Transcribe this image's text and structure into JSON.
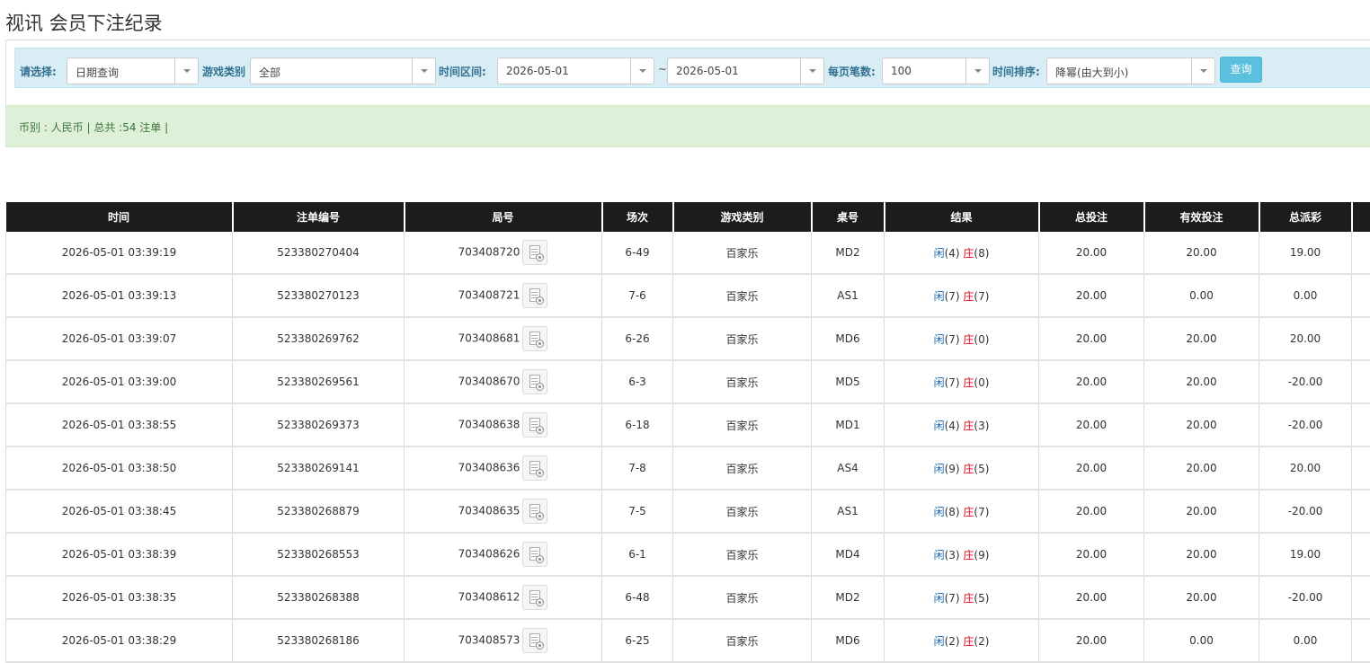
{
  "page": {
    "title": "视讯 会员下注纪录"
  },
  "filters": {
    "select_label": "请选择:",
    "select_value": "日期查询",
    "game_type_label": "游戏类别",
    "game_type_value": "全部",
    "time_range_label": "时间区间:",
    "date_from": "2026-05-01",
    "tilde": "~",
    "date_to": "2026-05-01",
    "per_page_label": "每页笔数:",
    "per_page_value": "100",
    "sort_label": "时间排序:",
    "sort_value": "降幂(由大到小)",
    "query_label": "查询"
  },
  "summary": {
    "text": "币别 : 人民币 | 总共 :54 注单 |"
  },
  "table": {
    "headers": [
      "时间",
      "注单编号",
      "局号",
      "场次",
      "游戏类别",
      "桌号",
      "结果",
      "总投注",
      "有效投注",
      "总派彩"
    ],
    "rows": [
      {
        "time": "2026-05-01 03:39:19",
        "order_no": "523380270404",
        "round_no": "703408720",
        "session": "6-49",
        "game": "百家乐",
        "table_no": "MD2",
        "player_label": "闲",
        "player_score": "(4)",
        "banker_label": "庄",
        "banker_score": "(8)",
        "total_bet": "20.00",
        "valid_bet": "20.00",
        "payout": "19.00",
        "payout_color": "normal"
      },
      {
        "time": "2026-05-01 03:39:13",
        "order_no": "523380270123",
        "round_no": "703408721",
        "session": "7-6",
        "game": "百家乐",
        "table_no": "AS1",
        "player_label": "闲",
        "player_score": "(7)",
        "banker_label": "庄",
        "banker_score": "(7)",
        "total_bet": "20.00",
        "valid_bet": "0.00",
        "payout": "0.00",
        "payout_color": "normal"
      },
      {
        "time": "2026-05-01 03:39:07",
        "order_no": "523380269762",
        "round_no": "703408681",
        "session": "6-26",
        "game": "百家乐",
        "table_no": "MD6",
        "player_label": "闲",
        "player_score": "(7)",
        "banker_label": "庄",
        "banker_score": "(0)",
        "total_bet": "20.00",
        "valid_bet": "20.00",
        "payout": "20.00",
        "payout_color": "normal"
      },
      {
        "time": "2026-05-01 03:39:00",
        "order_no": "523380269561",
        "round_no": "703408670",
        "session": "6-3",
        "game": "百家乐",
        "table_no": "MD5",
        "player_label": "闲",
        "player_score": "(7)",
        "banker_label": "庄",
        "banker_score": "(0)",
        "total_bet": "20.00",
        "valid_bet": "20.00",
        "payout": "-20.00",
        "payout_color": "red"
      },
      {
        "time": "2026-05-01 03:38:55",
        "order_no": "523380269373",
        "round_no": "703408638",
        "session": "6-18",
        "game": "百家乐",
        "table_no": "MD1",
        "player_label": "闲",
        "player_score": "(4)",
        "banker_label": "庄",
        "banker_score": "(3)",
        "total_bet": "20.00",
        "valid_bet": "20.00",
        "payout": "-20.00",
        "payout_color": "red"
      },
      {
        "time": "2026-05-01 03:38:50",
        "order_no": "523380269141",
        "round_no": "703408636",
        "session": "7-8",
        "game": "百家乐",
        "table_no": "AS4",
        "player_label": "闲",
        "player_score": "(9)",
        "banker_label": "庄",
        "banker_score": "(5)",
        "total_bet": "20.00",
        "valid_bet": "20.00",
        "payout": "20.00",
        "payout_color": "normal"
      },
      {
        "time": "2026-05-01 03:38:45",
        "order_no": "523380268879",
        "round_no": "703408635",
        "session": "7-5",
        "game": "百家乐",
        "table_no": "AS1",
        "player_label": "闲",
        "player_score": "(8)",
        "banker_label": "庄",
        "banker_score": "(7)",
        "total_bet": "20.00",
        "valid_bet": "20.00",
        "payout": "-20.00",
        "payout_color": "red"
      },
      {
        "time": "2026-05-01 03:38:39",
        "order_no": "523380268553",
        "round_no": "703408626",
        "session": "6-1",
        "game": "百家乐",
        "table_no": "MD4",
        "player_label": "闲",
        "player_score": "(3)",
        "banker_label": "庄",
        "banker_score": "(9)",
        "total_bet": "20.00",
        "valid_bet": "20.00",
        "payout": "19.00",
        "payout_color": "normal"
      },
      {
        "time": "2026-05-01 03:38:35",
        "order_no": "523380268388",
        "round_no": "703408612",
        "session": "6-48",
        "game": "百家乐",
        "table_no": "MD2",
        "player_label": "闲",
        "player_score": "(7)",
        "banker_label": "庄",
        "banker_score": "(5)",
        "total_bet": "20.00",
        "valid_bet": "20.00",
        "payout": "-20.00",
        "payout_color": "red"
      },
      {
        "time": "2026-05-01 03:38:29",
        "order_no": "523380268186",
        "round_no": "703408573",
        "session": "6-25",
        "game": "百家乐",
        "table_no": "MD6",
        "player_label": "闲",
        "player_score": "(2)",
        "banker_label": "庄",
        "banker_score": "(2)",
        "total_bet": "20.00",
        "valid_bet": "0.00",
        "payout": "0.00",
        "payout_color": "normal"
      }
    ]
  },
  "colors": {
    "header_bg": "#1c1c1c",
    "filter_bg": "#d9edf7",
    "summary_bg": "#dff0d8",
    "link_blue": "#1a68b7",
    "negative_red": "#e60012",
    "button": "#5bc0de"
  },
  "icons": {
    "result_detail": "result-detail-icon",
    "dropdown": "chevron-down-icon"
  }
}
